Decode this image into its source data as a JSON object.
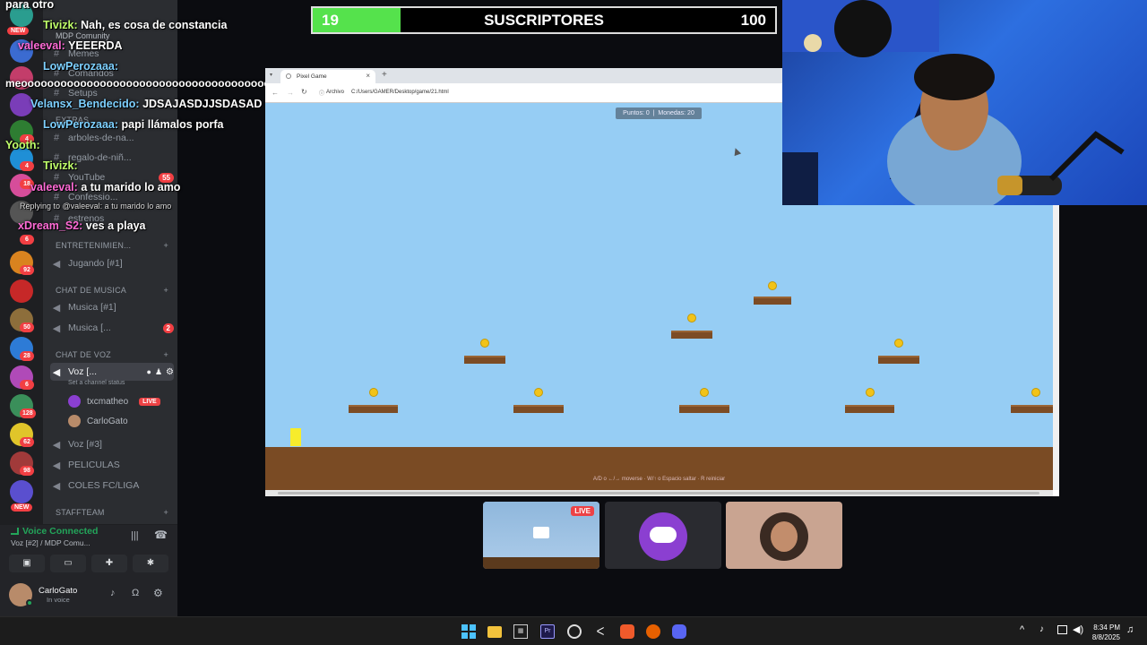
{
  "stream": {
    "subscribers": {
      "current": "19",
      "label": "SUSCRIPTORES",
      "goal": "100",
      "progress": 0.19
    }
  },
  "chat": [
    {
      "user": "",
      "msg": "para otro"
    },
    {
      "user": "Tivizk:",
      "msg": "Nah, es cosa de constancia"
    },
    {
      "user": "valeeval:",
      "msg": "YEEERDA"
    },
    {
      "user": "LowPerozaaa:",
      "msg": ""
    },
    {
      "user": "",
      "msg": "meooooooooooooooooooooooooooooooooooooooooooooooooo"
    },
    {
      "user": "Velansx_Bendecido:",
      "msg": "JDSAJASDJJSDASAD"
    },
    {
      "user": "LowPerozaaa:",
      "msg": "papi llámalos porfa"
    },
    {
      "user": "Yooth:",
      "msg": ""
    },
    {
      "user": "Tivizk:",
      "msg": ""
    },
    {
      "user": "valeeval:",
      "msg": "a tu marido lo amo"
    },
    {
      "user": "",
      "msg": "Replying to @valeeval: a tu marido lo amo"
    },
    {
      "user": "xDream_S2:",
      "msg": "ves a playa"
    }
  ],
  "server_rail": {
    "badges": [
      "4",
      "4",
      "18",
      "6",
      "92",
      "50",
      "28",
      "6",
      "128",
      "62",
      "98",
      "2"
    ],
    "new_label": "NEW"
  },
  "sidebar": {
    "server_title": "MDP Comunity",
    "channels_top": [
      {
        "name": "Memes"
      },
      {
        "name": "Comandos"
      },
      {
        "name": "Setups"
      },
      {
        "name": "EXTRAS"
      },
      {
        "name": "arboles-de-na..."
      },
      {
        "name": "regalo-de-niñ..."
      },
      {
        "name": "YouTube",
        "badge": "55"
      },
      {
        "name": "Confessio..."
      },
      {
        "name": "estrenos"
      }
    ],
    "categories": {
      "entretenimiento": "ENTRETENIMIEN...",
      "musica": "CHAT DE MUSICA",
      "voz": "CHAT DE VOZ"
    },
    "voice_channels": {
      "jugando": "Jugando [#1]",
      "musica1": "Musica [#1]",
      "musica2": "Musica [...",
      "musica2_badge": "2",
      "voz_active": "Voz [...",
      "channel_status": "Set a channel status",
      "voz3": "Voz [#3]",
      "peliculas": "PELICULAS",
      "coles": "COLES FC/LIGA",
      "staff": "StaffTeam"
    },
    "members": [
      {
        "name": "txcmatheo",
        "live": "LIVE"
      },
      {
        "name": "CarloGato"
      }
    ],
    "voice_connected": {
      "title": "Voice Connected",
      "channel": "Voz [#2] / MDP Comu..."
    },
    "user": {
      "name": "CarloGato",
      "status": "In voice"
    }
  },
  "browser": {
    "tab_title": "Pixel Game",
    "address_label": "Archivo",
    "address_path": "C:/Users/GAMER/Desktop/game/21.html",
    "game": {
      "points_label": "Puntos: 0",
      "coins_label": "Monedas: 20",
      "hint": "A/D o ←/→ moverse · W/↑ o Espacio saltar · R reiniciar"
    }
  },
  "tiles": {
    "live": "LIVE"
  },
  "taskbar": {
    "time": "8:34 PM",
    "date": "8/8/2025"
  },
  "colors": {
    "discord_bg": "#2b2d31",
    "accent_green": "#55e24c",
    "sky": "#96cdf4",
    "ground": "#7a4b24",
    "coin": "#f2c318",
    "live_red": "#ed4245"
  }
}
